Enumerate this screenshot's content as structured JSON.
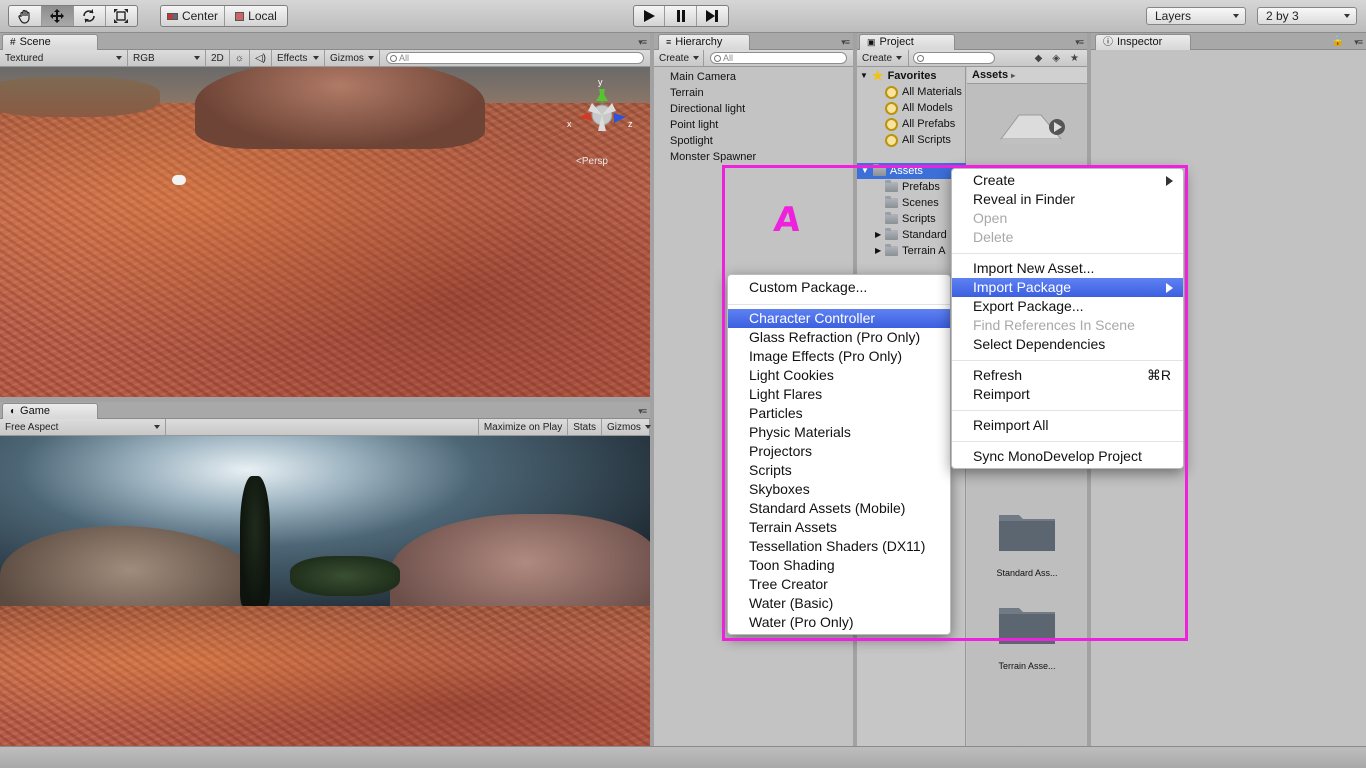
{
  "toolbar": {
    "pivot_center": "Center",
    "pivot_local": "Local",
    "layers_label": "Layers",
    "layout_label": "2 by 3"
  },
  "scene": {
    "tab": "Scene",
    "draw_mode": "Textured",
    "render_mode": "RGB",
    "btn_2d": "2D",
    "effects": "Effects",
    "gizmos": "Gizmos",
    "search_placeholder": "All",
    "axis_y": "y",
    "axis_x": "x",
    "axis_z": "z",
    "persp": "Persp"
  },
  "game": {
    "tab": "Game",
    "aspect": "Free Aspect",
    "maximize": "Maximize on Play",
    "stats": "Stats",
    "gizmos": "Gizmos"
  },
  "hierarchy": {
    "tab": "Hierarchy",
    "create": "Create",
    "search_placeholder": "All",
    "items": [
      "Main Camera",
      "Terrain",
      "Directional light",
      "Point light",
      "Spotlight",
      "Monster Spawner"
    ]
  },
  "project": {
    "tab": "Project",
    "create": "Create",
    "favorites_label": "Favorites",
    "favorites": [
      "All Materials",
      "All Models",
      "All Prefabs",
      "All Scripts"
    ],
    "assets_label": "Assets",
    "folders": [
      "Prefabs",
      "Scenes",
      "Scripts",
      "Standard",
      "Terrain A"
    ],
    "breadcrumb": "Assets",
    "grid_items": [
      "Standard Ass...",
      "Terrain Asse..."
    ]
  },
  "inspector": {
    "tab": "Inspector"
  },
  "annotation": {
    "label": "A",
    "color": "#ee22dd"
  },
  "context_menu": {
    "items": [
      {
        "label": "Create",
        "state": "normal",
        "submenu": true
      },
      {
        "label": "Reveal in Finder",
        "state": "normal"
      },
      {
        "label": "Open",
        "state": "disabled"
      },
      {
        "label": "Delete",
        "state": "disabled"
      },
      {
        "label": "Import New Asset...",
        "state": "normal"
      },
      {
        "label": "Import Package",
        "state": "selected",
        "submenu": true
      },
      {
        "label": "Export Package...",
        "state": "normal"
      },
      {
        "label": "Find References In Scene",
        "state": "disabled"
      },
      {
        "label": "Select Dependencies",
        "state": "normal"
      },
      {
        "label": "Refresh",
        "state": "normal",
        "shortcut": "⌘R"
      },
      {
        "label": "Reimport",
        "state": "normal"
      },
      {
        "label": "Reimport All",
        "state": "normal"
      },
      {
        "label": "Sync MonoDevelop Project",
        "state": "normal"
      }
    ]
  },
  "package_menu": {
    "items": [
      {
        "label": "Custom Package...",
        "state": "normal"
      },
      {
        "label": "Character Controller",
        "state": "selected"
      },
      {
        "label": "Glass Refraction (Pro Only)",
        "state": "normal"
      },
      {
        "label": "Image Effects (Pro Only)",
        "state": "normal"
      },
      {
        "label": "Light Cookies",
        "state": "normal"
      },
      {
        "label": "Light Flares",
        "state": "normal"
      },
      {
        "label": "Particles",
        "state": "normal"
      },
      {
        "label": "Physic Materials",
        "state": "normal"
      },
      {
        "label": "Projectors",
        "state": "normal"
      },
      {
        "label": "Scripts",
        "state": "normal"
      },
      {
        "label": "Skyboxes",
        "state": "normal"
      },
      {
        "label": "Standard Assets (Mobile)",
        "state": "normal"
      },
      {
        "label": "Terrain Assets",
        "state": "normal"
      },
      {
        "label": "Tessellation Shaders (DX11)",
        "state": "normal"
      },
      {
        "label": "Toon Shading",
        "state": "normal"
      },
      {
        "label": "Tree Creator",
        "state": "normal"
      },
      {
        "label": "Water (Basic)",
        "state": "normal"
      },
      {
        "label": "Water (Pro Only)",
        "state": "normal"
      }
    ]
  }
}
